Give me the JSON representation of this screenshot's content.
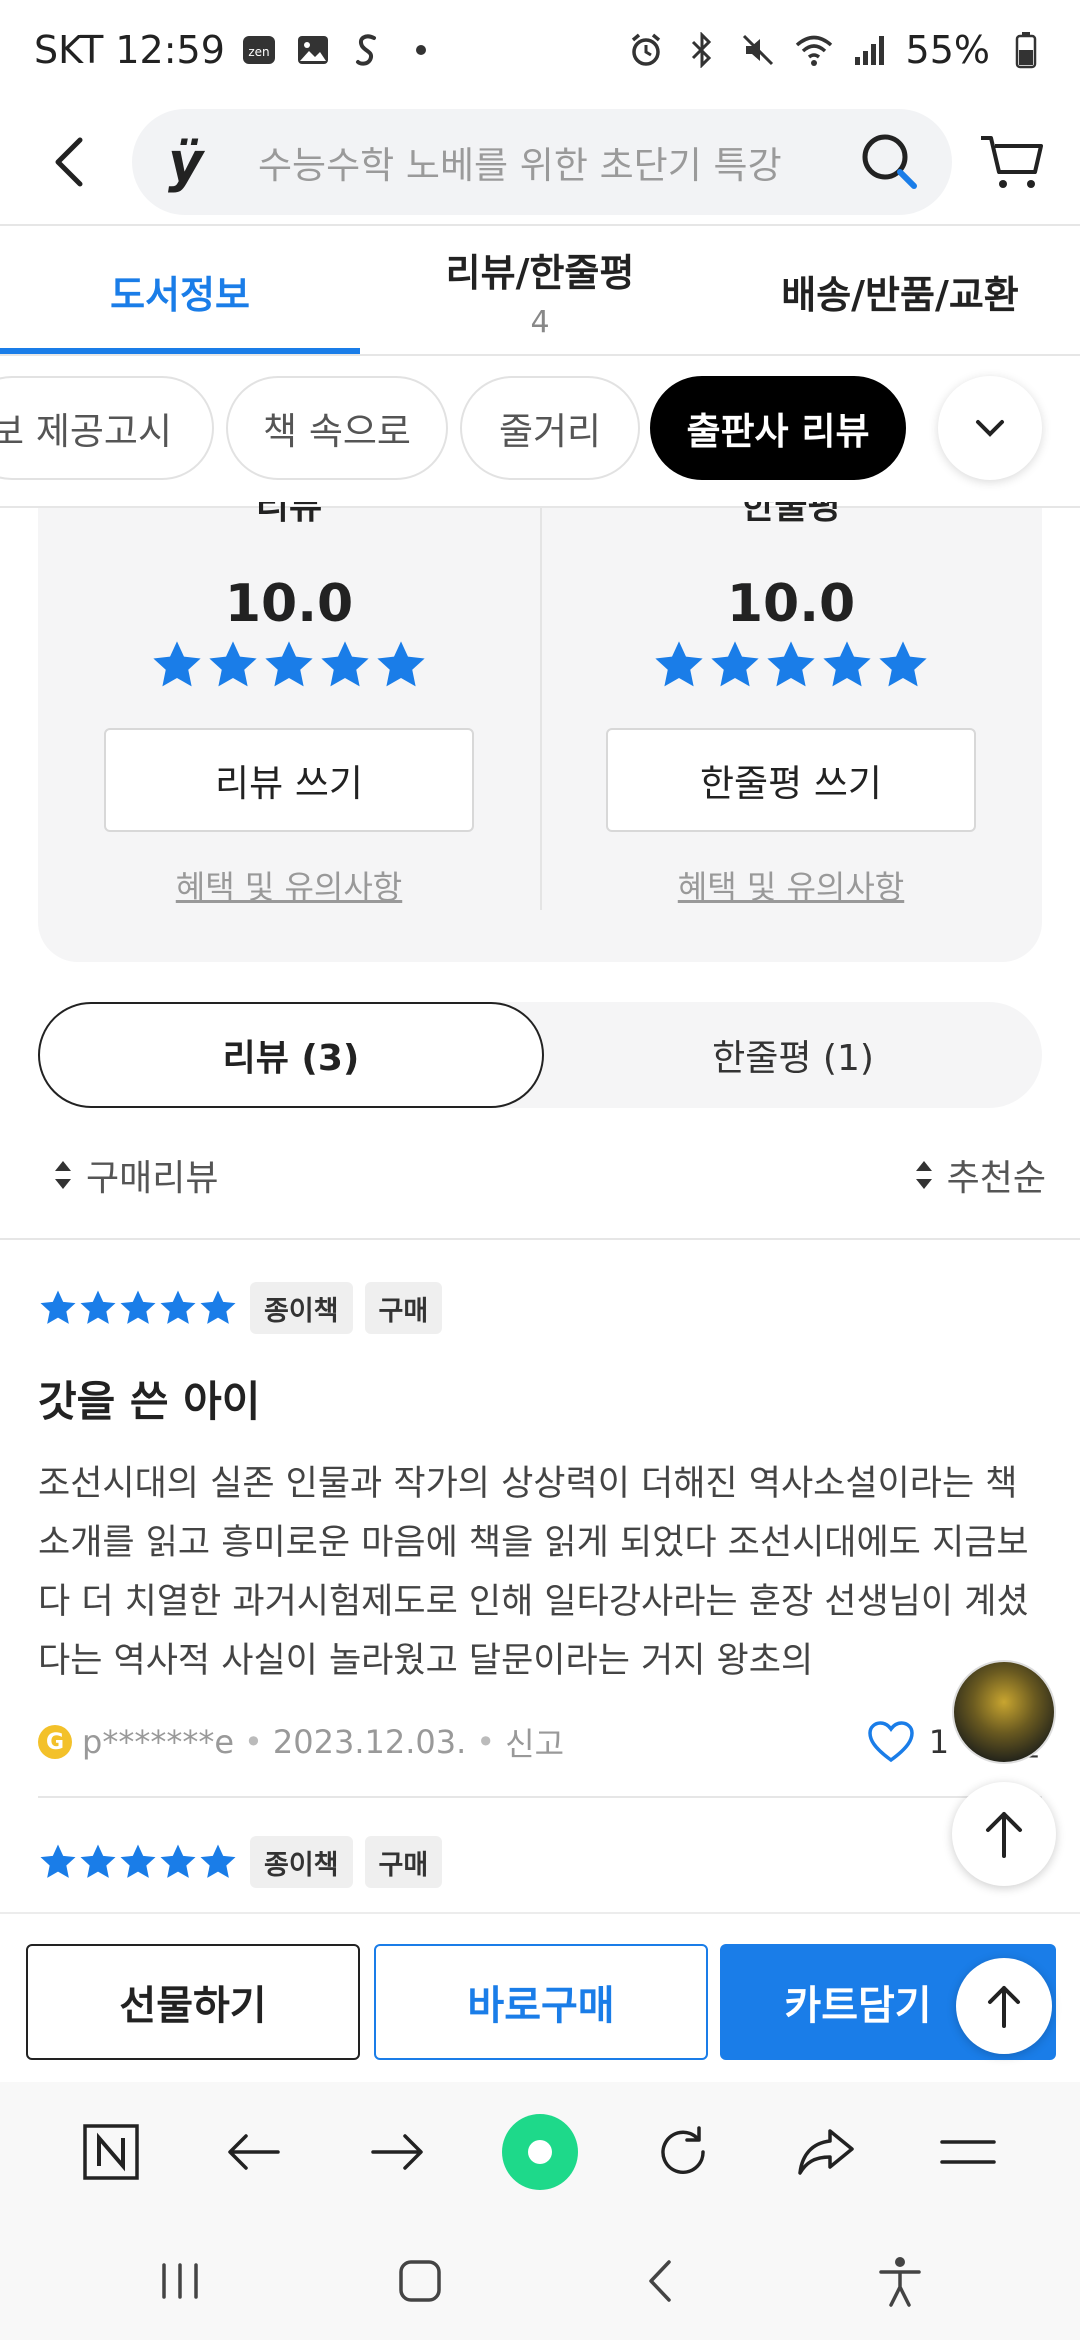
{
  "status_bar": {
    "carrier_time": "SKT 12:59",
    "battery": "55%"
  },
  "search": {
    "logo": "ÿ",
    "placeholder": "수능수학 노베를 위한 초단기 특강"
  },
  "tabs": [
    {
      "label": "도서정보",
      "count": ""
    },
    {
      "label": "리뷰/한줄평",
      "count": "4"
    },
    {
      "label": "배송/반품/교환",
      "count": ""
    }
  ],
  "chips": [
    "보 제공고시",
    "책 속으로",
    "줄거리",
    "출판사 리뷰"
  ],
  "rating": {
    "left": {
      "label": "리뷰",
      "score": "10.0",
      "button": "리뷰 쓰기",
      "link": "혜택 및 유의사항",
      "stars": 5
    },
    "right": {
      "label": "한줄평",
      "score": "10.0",
      "button": "한줄평 쓰기",
      "link": "혜택 및 유의사항",
      "stars": 5
    }
  },
  "segment": {
    "review": "리뷰 (3)",
    "oneline": "한줄평 (1)"
  },
  "sort": {
    "left": "구매리뷰",
    "right": "추천순"
  },
  "reviews": [
    {
      "stars": 5,
      "badges": [
        "종이책",
        "구매"
      ],
      "title": "갓을 쓴 아이",
      "body": "조선시대의 실존 인물과 작가의 상상력이 더해진 역사소설이라는 책 소개를 읽고 흥미로운 마음에 책을 읽게 되었다  조선시대에도 지금보다 더 치열한 과거시험제도로 인해 일타강사라는 훈장 선생님이 계셨다는 역사적 사실이 놀라웠고 달문이라는 거지 왕초의",
      "user_grade": "G",
      "user": "p*******e",
      "date": "2023.12.03.",
      "report": "신고",
      "likes": "1",
      "comment": "댓글"
    },
    {
      "stars": 5,
      "badges": [
        "종이책",
        "구매"
      ]
    }
  ],
  "actions": {
    "gift": "선물하기",
    "buy": "바로구매",
    "cart": "카트담기"
  },
  "colors": {
    "accent": "#1a7de8",
    "star": "#1a7de8",
    "browser_home": "#1ed98a"
  }
}
